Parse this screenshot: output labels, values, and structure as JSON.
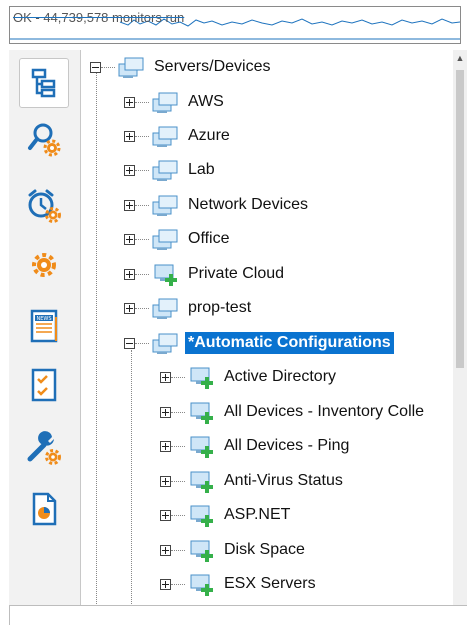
{
  "status": {
    "text": "OK - 44,739,578 monitors run"
  },
  "toolbar": {
    "items": [
      {
        "name": "tree-view",
        "icon": "tree-view-icon",
        "active": true
      },
      {
        "name": "search-settings",
        "icon": "magnifier-gear-icon"
      },
      {
        "name": "scheduled-monitors",
        "icon": "alarm-clock-gear-icon"
      },
      {
        "name": "settings",
        "icon": "gear-icon"
      },
      {
        "name": "news",
        "icon": "news-icon"
      },
      {
        "name": "checklist",
        "icon": "checklist-icon"
      },
      {
        "name": "tools",
        "icon": "wrench-gear-icon"
      },
      {
        "name": "reports",
        "icon": "report-chart-icon"
      }
    ]
  },
  "tree": {
    "root": "Servers/Devices",
    "groups": [
      "AWS",
      "Azure",
      "Lab",
      "Network Devices",
      "Office",
      "Private Cloud",
      "prop-test"
    ],
    "selected": "*Automatic Configurations",
    "children": [
      "Active Directory",
      "All Devices - Inventory Colle",
      "All Devices - Ping",
      "Anti-Virus Status",
      "ASP.NET",
      "Disk Space",
      "ESX Servers"
    ]
  },
  "colors": {
    "accent": "#0a73d0",
    "icon_orange": "#f08c1a",
    "icon_blue": "#1f6fb7",
    "plus_green": "#35b04a"
  }
}
